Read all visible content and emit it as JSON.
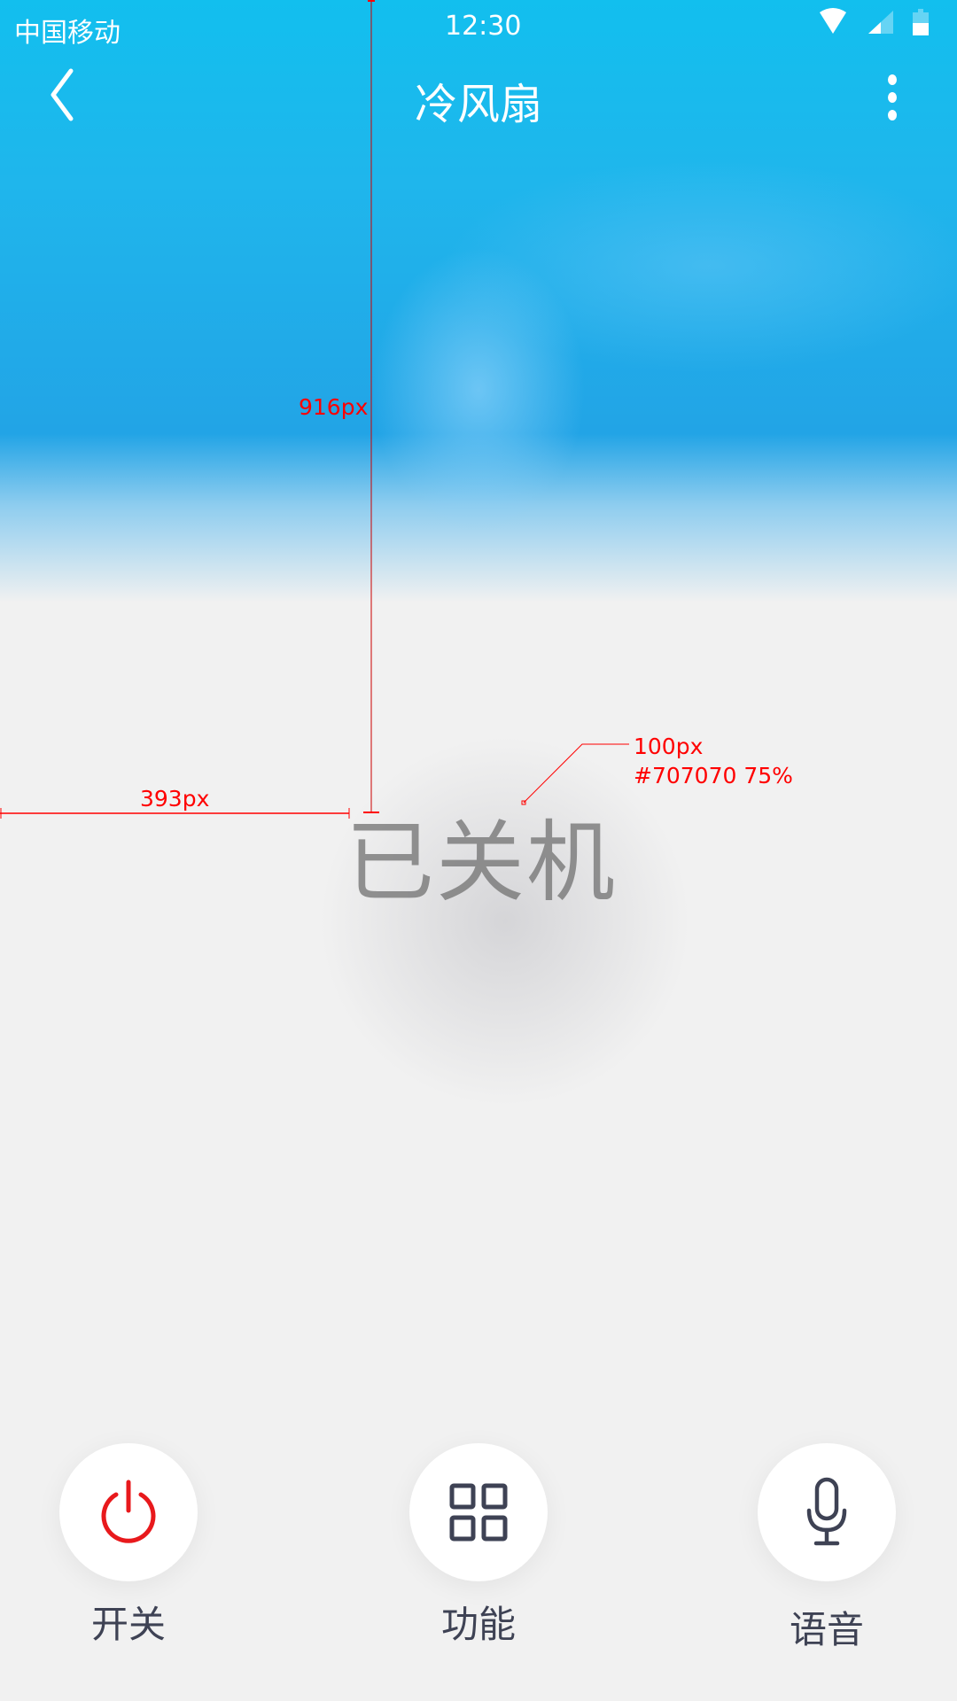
{
  "status_bar": {
    "carrier": "中国移动",
    "time": "12:30",
    "icons": [
      "wifi-icon",
      "signal-icon",
      "battery-icon"
    ]
  },
  "header": {
    "title": "冷风扇",
    "back_icon": "chevron-left-icon",
    "menu_icon": "more-vertical-icon"
  },
  "main": {
    "state_text": "已关机"
  },
  "annotations": {
    "vertical": "916px",
    "horizontal": "393px",
    "font_size": "100px",
    "color": "#707070 75%"
  },
  "controls": [
    {
      "label": "开关",
      "icon": "power-icon",
      "color": "#e8191c"
    },
    {
      "label": "功能",
      "icon": "grid-icon",
      "color": "#3e4254"
    },
    {
      "label": "语音",
      "icon": "microphone-icon",
      "color": "#3e4254"
    }
  ]
}
